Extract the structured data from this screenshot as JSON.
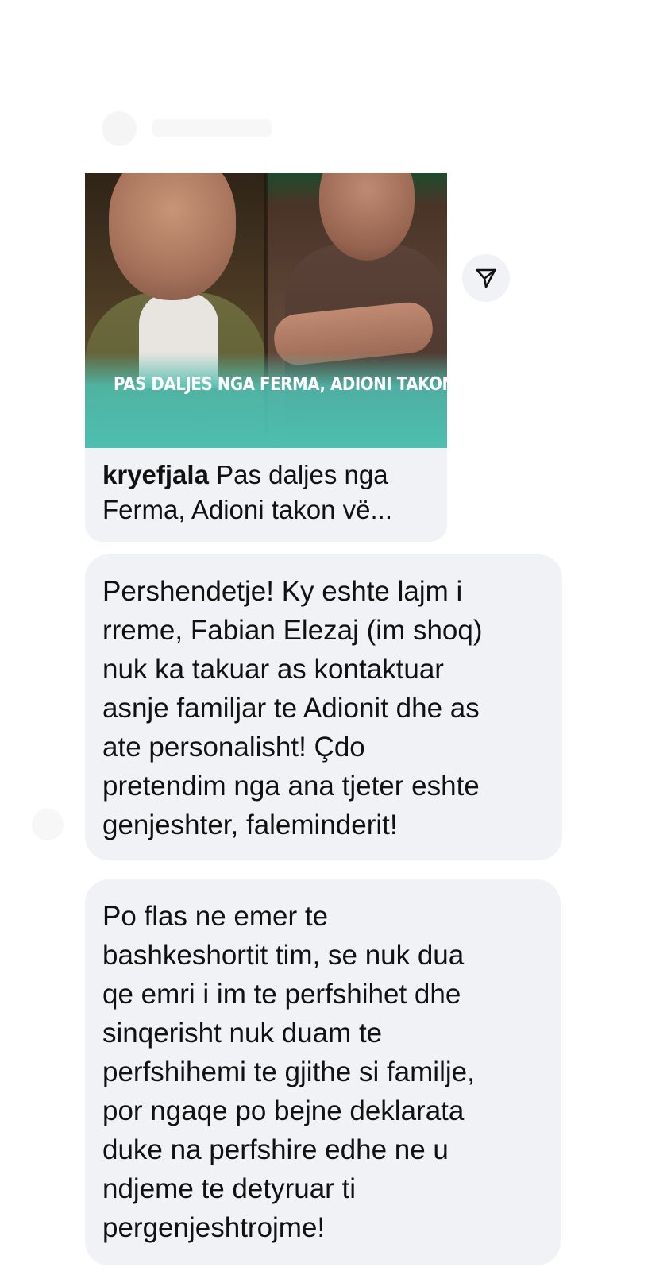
{
  "shared_post": {
    "image_headline": "PAS DALJES NGA FERMA, ADIONI TAKON VËLLAIN E OLËS",
    "author": "kryefjala",
    "caption": "Pas daljes nga\nFerma, Adioni takon vë..."
  },
  "share_button": {
    "icon": "send-icon"
  },
  "messages": [
    {
      "text": "Pershendetje! Ky eshte lajm i\nrreme, Fabian Elezaj (im shoq)\nnuk ka takuar as kontaktuar\nasnje familjar te Adionit dhe as\nate personalisht! Çdo\npretendim nga ana tjeter eshte\ngenjeshter, faleminderit!"
    },
    {
      "text": "Po flas ne emer te\nbashkeshortit tim, se nuk dua\nqe emri i im te perfshihet dhe\nsinqerisht nuk duam te\nperfshihemi te gjithe si familje,\npor ngaqe po bejne deklarata\nduke na perfshire edhe ne u\nndjeme te detyruar ti\npergenjeshtrojme!"
    }
  ],
  "colors": {
    "bubble_bg": "#f1f2f5",
    "teal_band": "#4dbfb0",
    "text": "#111111"
  }
}
